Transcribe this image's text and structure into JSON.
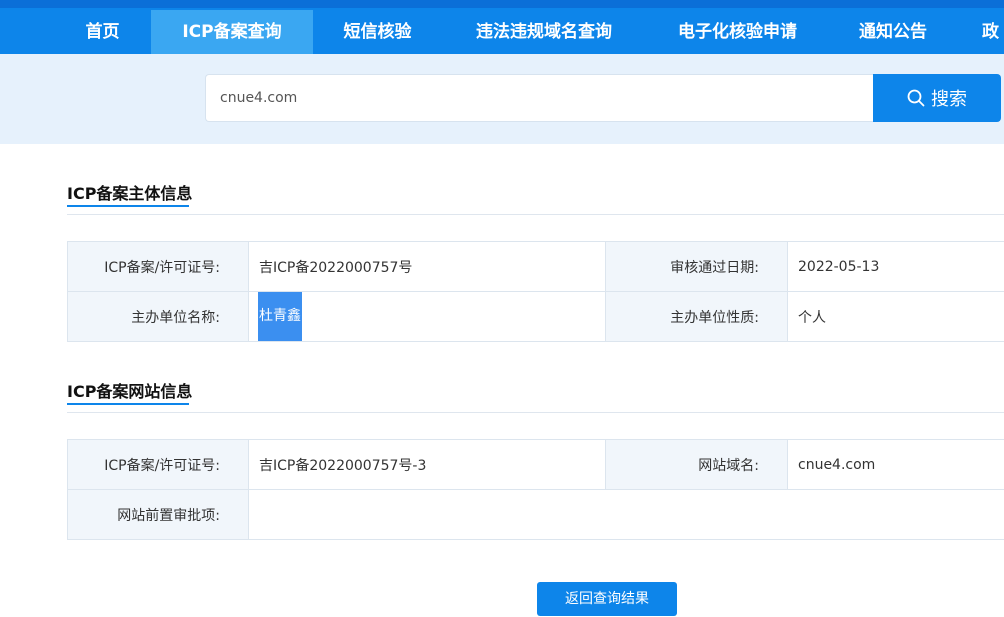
{
  "nav": {
    "items": [
      {
        "label": "首页",
        "active": false
      },
      {
        "label": "ICP备案查询",
        "active": true
      },
      {
        "label": "短信核验",
        "active": false
      },
      {
        "label": "违法违规域名查询",
        "active": false
      },
      {
        "label": "电子化核验申请",
        "active": false
      },
      {
        "label": "通知公告",
        "active": false
      },
      {
        "label": "政",
        "active": false
      }
    ]
  },
  "search": {
    "value": "cnue4.com",
    "button_label": "搜索",
    "icon": "search-icon"
  },
  "subject_section": {
    "title": "ICP备案主体信息",
    "rows": [
      {
        "label1": "ICP备案/许可证号:",
        "value1": "吉ICP备2022000757号",
        "label2": "审核通过日期:",
        "value2": "2022-05-13"
      },
      {
        "label1": "主办单位名称:",
        "value1": "杜青鑫",
        "label2": "主办单位性质:",
        "value2": "个人"
      }
    ]
  },
  "website_section": {
    "title": "ICP备案网站信息",
    "rows": [
      {
        "label1": "ICP备案/许可证号:",
        "value1": "吉ICP备2022000757号-3",
        "label2": "网站域名:",
        "value2": "cnue4.com"
      },
      {
        "label1": "网站前置审批项:",
        "value1": ""
      }
    ]
  },
  "back_button_label": "返回查询结果",
  "colors": {
    "brand": "#0d85ea",
    "nav_active": "#3aa7f2",
    "search_band": "#e6f1fc",
    "label_bg": "#f1f6fb",
    "highlight": "#3b8ff0"
  }
}
